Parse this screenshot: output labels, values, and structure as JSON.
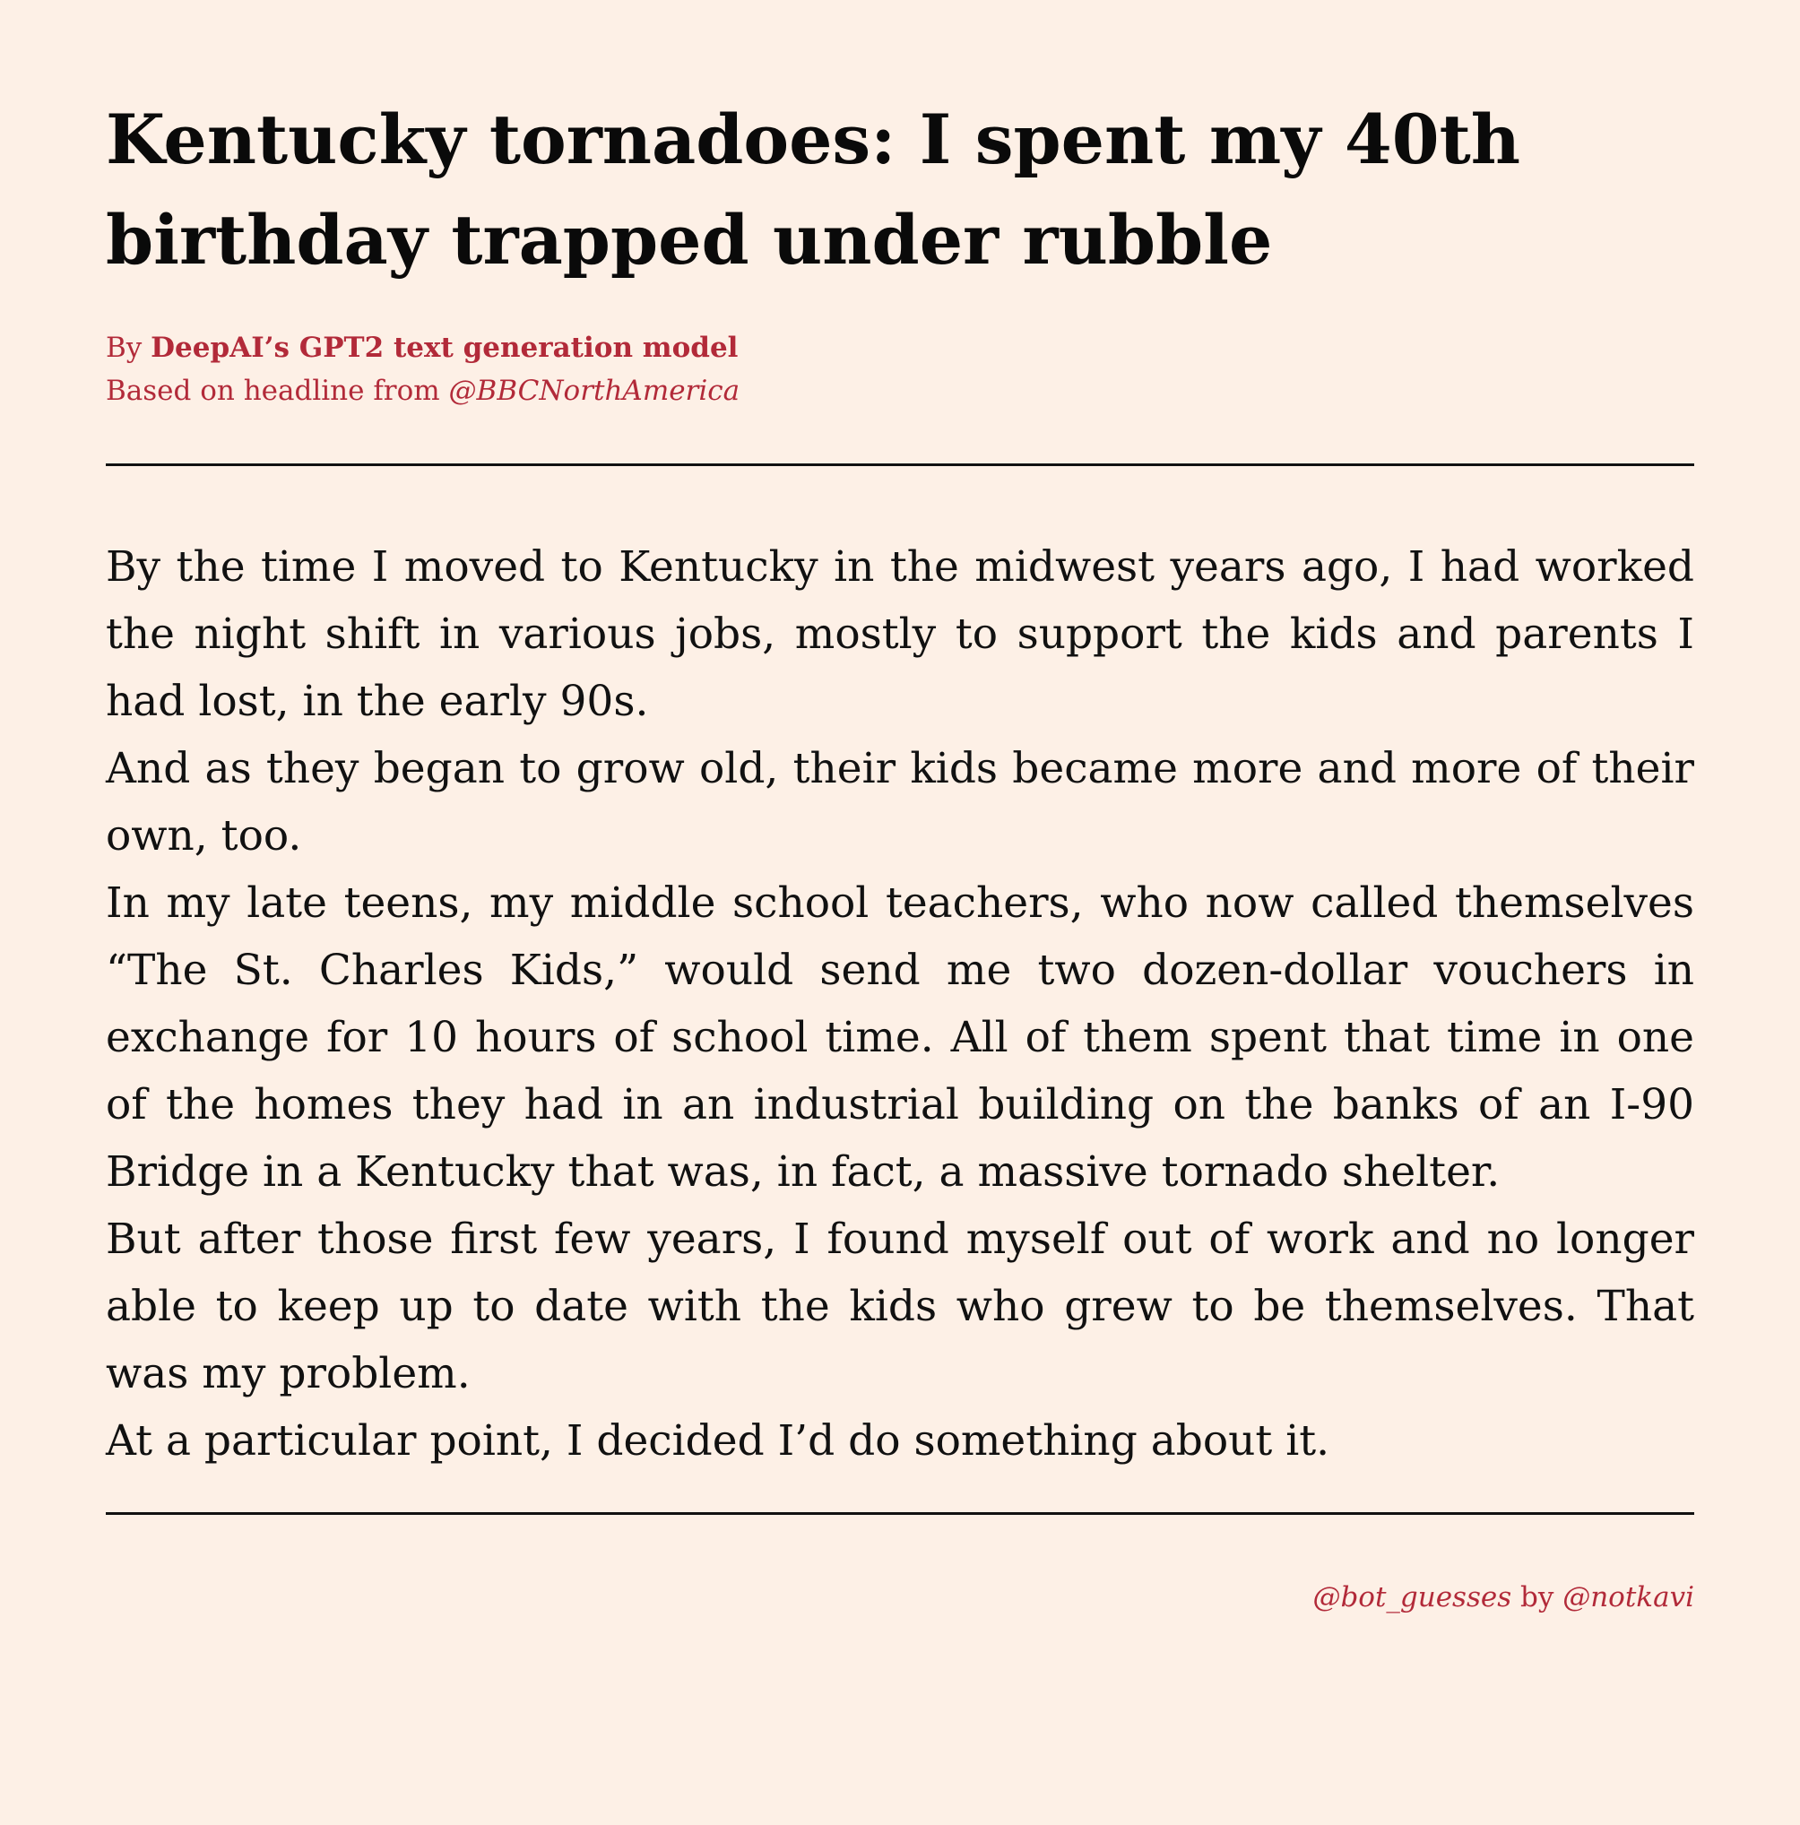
{
  "article": {
    "headline": "Kentucky tornadoes: I spent my 40th birthday trapped under rubble",
    "byline_prefix": "By ",
    "byline_author": "DeepAI’s GPT2 text generation model",
    "source_prefix": "Based on headline from ",
    "source_handle": "@BBCNorthAmerica",
    "paragraphs": [
      "By the time I moved to Kentucky in the midwest years ago, I had worked the night shift in various jobs, mostly to support the kids and parents I had lost, in the early 90s.",
      "And as they began to grow old, their kids became more and more of their own, too.",
      "In my late teens, my middle school teachers, who now called them­selves “The St.  Charles Kids,” would send me two dozen-dollar vouchers in exchange for 10 hours of school time. All of them spent that time in one of the homes they had in an industrial building on the banks of an I-90 Bridge in a Kentucky that was, in fact, a massive tornado shelter.",
      "But after those first few years, I found myself out of work and no longer able to keep up to date with the kids who grew to be them­selves. That was my problem.",
      "At a particular point, I decided I’d do something about it."
    ]
  },
  "footer": {
    "bot_handle": "@bot_guesses",
    "by_text": " by ",
    "author_handle": "@notkavi"
  }
}
